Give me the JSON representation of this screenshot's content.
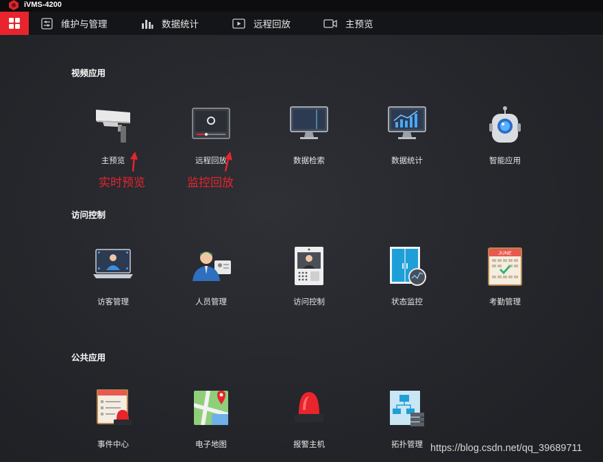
{
  "window": {
    "title": "iVMS-4200"
  },
  "menu": {
    "items": [
      {
        "label": "维护与管理",
        "icon": "maintenance-icon"
      },
      {
        "label": "数据统计",
        "icon": "statistics-icon"
      },
      {
        "label": "远程回放",
        "icon": "playback-icon"
      },
      {
        "label": "主预览",
        "icon": "preview-icon"
      }
    ]
  },
  "sections": [
    {
      "title": "视频应用",
      "tiles": [
        "主预览",
        "远程回放",
        "数据检索",
        "数据统计",
        "智能应用"
      ]
    },
    {
      "title": "访问控制",
      "tiles": [
        "访客管理",
        "人员管理",
        "访问控制",
        "状态监控",
        "考勤管理"
      ]
    },
    {
      "title": "公共应用",
      "tiles": [
        "事件中心",
        "电子地图",
        "报警主机",
        "拓扑管理"
      ]
    }
  ],
  "annotations": {
    "live_preview": "实时预览",
    "playback": "监控回放"
  },
  "calendar_month": "JUNE",
  "watermark": "https://blog.csdn.net/qq_39689711",
  "colors": {
    "accent": "#e8242d",
    "background": "#26282d"
  }
}
